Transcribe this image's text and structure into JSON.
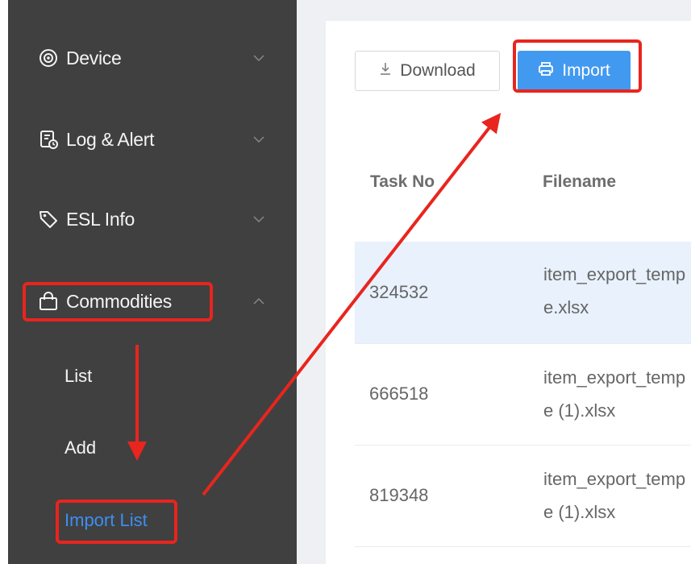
{
  "sidebar": {
    "items": [
      {
        "label": "Device",
        "icon": "device-icon",
        "chevron": "down"
      },
      {
        "label": "Log & Alert",
        "icon": "log-alert-icon",
        "chevron": "down"
      },
      {
        "label": "ESL Info",
        "icon": "tag-icon",
        "chevron": "down"
      },
      {
        "label": "Commodities",
        "icon": "shopping-bag-icon",
        "chevron": "up"
      }
    ],
    "subitems": [
      {
        "label": "List"
      },
      {
        "label": "Add"
      },
      {
        "label": "Import List",
        "active": true
      }
    ]
  },
  "toolbar": {
    "download_label": "Download",
    "import_label": "Import"
  },
  "table": {
    "columns": [
      "Task No",
      "Filename"
    ],
    "rows": [
      {
        "task_no": "324532",
        "filename_line1": "item_export_temp",
        "filename_line2": "e.xlsx",
        "selected": true
      },
      {
        "task_no": "666518",
        "filename_line1": "item_export_temp",
        "filename_line2": "e (1).xlsx",
        "selected": false
      },
      {
        "task_no": "819348",
        "filename_line1": "item_export_temp",
        "filename_line2": "e (1).xlsx",
        "selected": false
      }
    ]
  },
  "colors": {
    "sidebar_bg": "#404040",
    "accent": "#4299f0",
    "highlight": "#e8251e",
    "selected_row": "#e8f1fc"
  }
}
